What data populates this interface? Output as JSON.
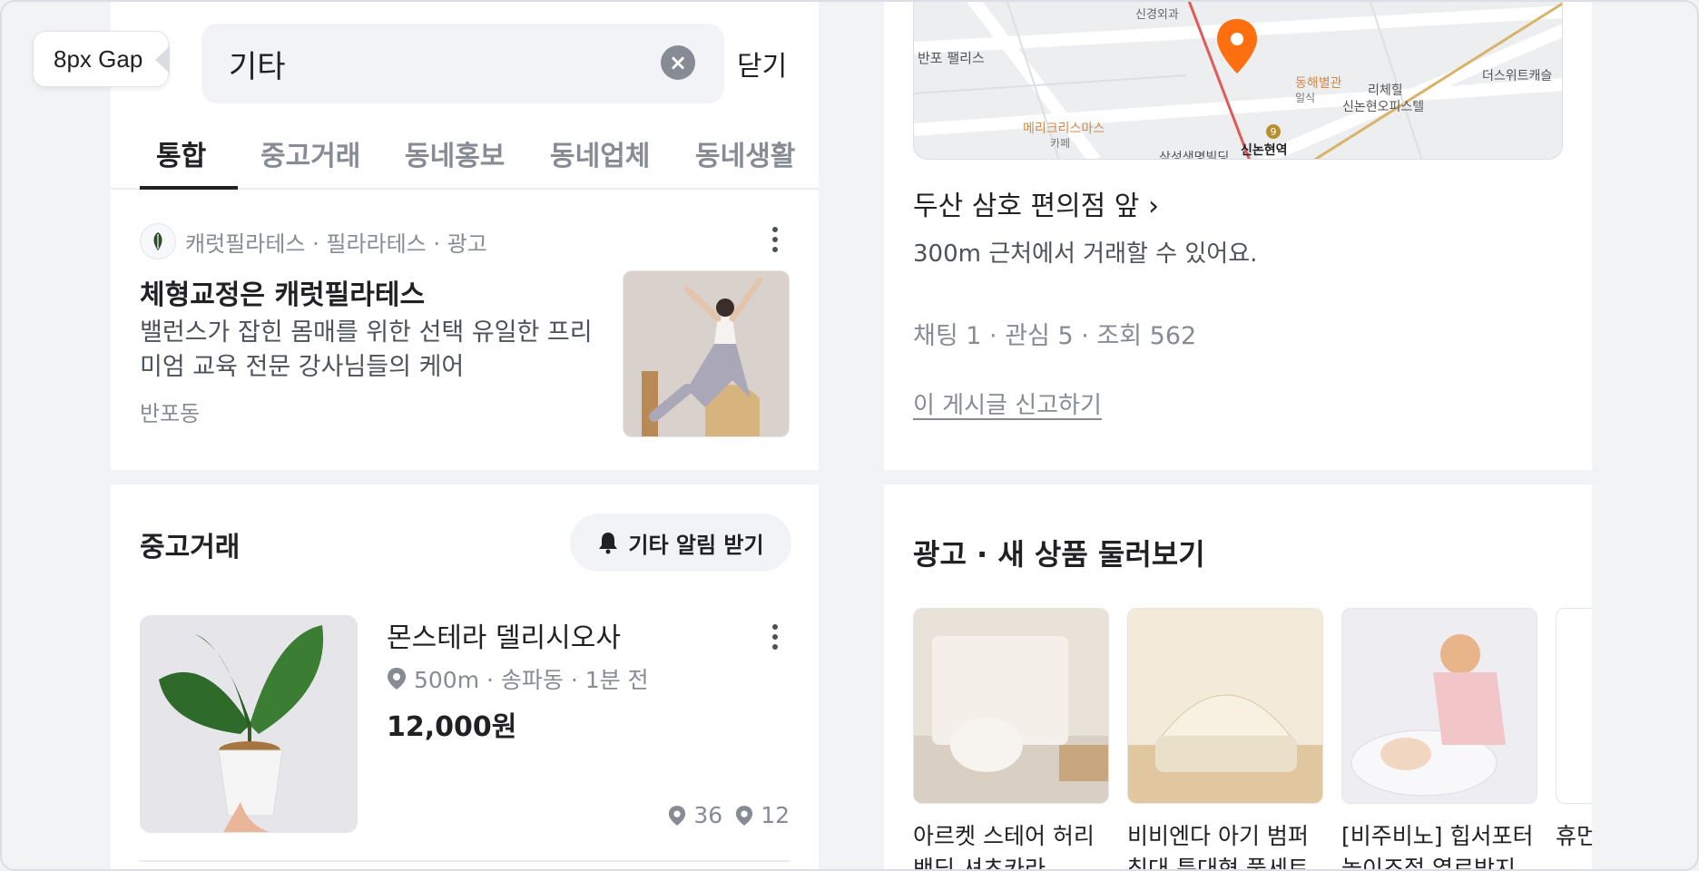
{
  "overlay": {
    "gap_label": "8px Gap"
  },
  "search": {
    "query": "기타",
    "clear_icon": "×",
    "close_label": "닫기"
  },
  "tabs": [
    {
      "label": "통합",
      "active": true
    },
    {
      "label": "중고거래",
      "active": false
    },
    {
      "label": "동네홍보",
      "active": false
    },
    {
      "label": "동네업체",
      "active": false
    },
    {
      "label": "동네생활",
      "active": false
    }
  ],
  "ad": {
    "meta": "캐럿필라테스 · 필라라테스 · 광고",
    "title": "체형교정은 캐럿필라테스",
    "description": "밸런스가 잡힌 몸매를 위한 선택 유일한 프리미엄 교육 전문 강사님들의 케어",
    "location": "반포동"
  },
  "market": {
    "section_title": "중고거래",
    "alert_label": "기타 알림 받기",
    "item": {
      "title": "몬스테라 델리시오사",
      "meta": "500m · 송파동 · 1분 전",
      "price": "12,000원",
      "stat_a": "36",
      "stat_b": "12"
    }
  },
  "detail": {
    "map_labels": {
      "a": "신경외과",
      "b": "반포 팰리스",
      "c": "동해별관",
      "d": "일식",
      "e": "리체힐",
      "f": "신논현오피스텔",
      "g": "더스위트캐슬",
      "h": "메리크리스마스",
      "i": "카페",
      "j": "삼성생명빌딩",
      "k": "신논현역",
      "l": "9"
    },
    "place": "두산 삼호 편의점 앞",
    "trade_desc": "300m 근처에서 거래할 수 있어요.",
    "stats": "채팅 1 · 관심 5 · 조회 562",
    "report": "이 게시글 신고하기"
  },
  "ads_section": {
    "title": "광고 · 새 상품 둘러보기",
    "cards": [
      {
        "name": "아르켓 스테어 허리 밴딩 셔츠카라"
      },
      {
        "name": "비비엔다 아기 범퍼 침대 특대형 풀세트"
      },
      {
        "name": "[비주비노] 힙서포터 놀이조절 열료방지"
      },
      {
        "name": "휴먼 무용"
      }
    ]
  },
  "colors": {
    "accent": "#ff6f0f",
    "text": "#212124",
    "muted": "#868b94",
    "divider": "#eaebee"
  }
}
